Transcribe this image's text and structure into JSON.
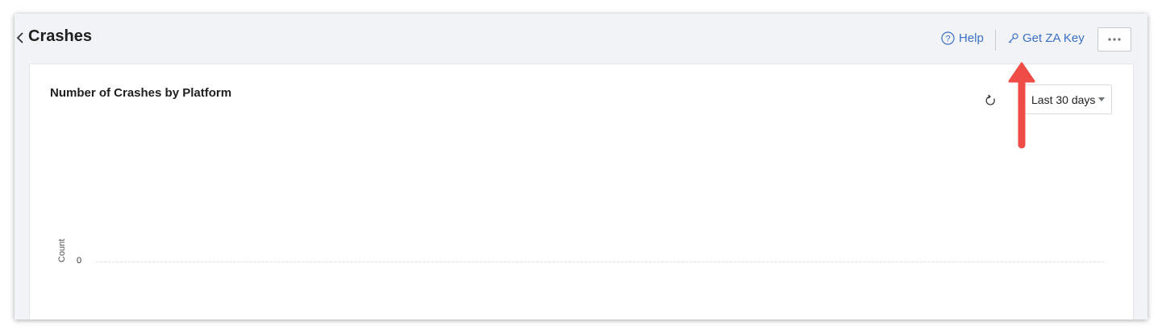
{
  "header": {
    "title": "Crashes",
    "help_label": "Help",
    "key_label": "Get ZA Key"
  },
  "card": {
    "title": "Number of Crashes by Platform",
    "range_selected": "Last 30 days"
  },
  "chart_data": {
    "type": "line",
    "title": "Number of Crashes by Platform",
    "ylabel": "Count",
    "yticks": [
      "0"
    ],
    "series": [],
    "grid": false
  },
  "colors": {
    "accent": "#3a6fc7",
    "annotation": "#ef4b47",
    "background": "#f2f3f6"
  },
  "icons": [
    "chevron-left-icon",
    "help-circle-icon",
    "key-icon",
    "more-dots-icon",
    "refresh-icon",
    "caret-down-icon",
    "arrow-up-icon"
  ]
}
